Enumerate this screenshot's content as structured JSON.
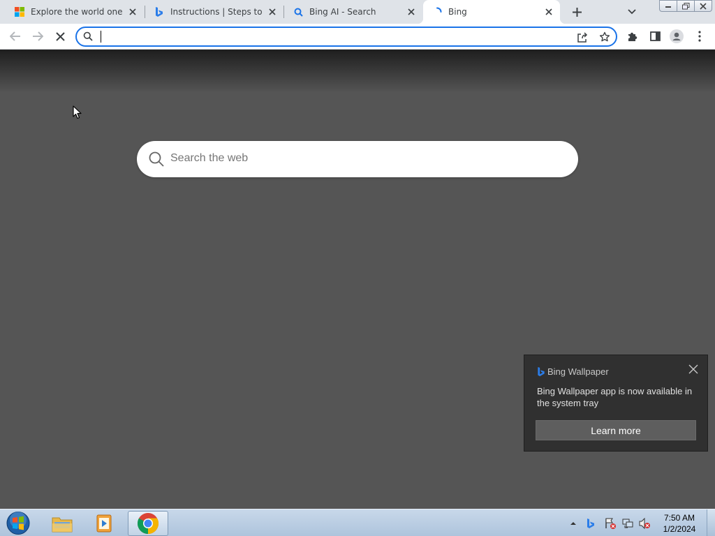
{
  "tabs": [
    {
      "title": "Explore the world one ph",
      "favicon": "microsoft-icon"
    },
    {
      "title": "Instructions | Steps to ins",
      "favicon": "bing-icon"
    },
    {
      "title": "Bing AI - Search",
      "favicon": "search-icon"
    },
    {
      "title": "Bing",
      "favicon": "loading-spinner-icon",
      "active": true
    }
  ],
  "omnibox": {
    "value": "",
    "placeholder": ""
  },
  "page": {
    "search_placeholder": "Search the web"
  },
  "notification": {
    "app_name": "Bing Wallpaper",
    "message": "Bing Wallpaper app is now available in the system tray",
    "button_label": "Learn more"
  },
  "taskbar": {
    "apps": [
      "file-explorer-icon",
      "media-player-icon",
      "chrome-icon"
    ],
    "clock_time": "7:50 AM",
    "clock_date": "1/2/2024"
  },
  "colors": {
    "accent": "#1a73e8",
    "page_bg": "#555555",
    "toast_bg": "#303030"
  }
}
